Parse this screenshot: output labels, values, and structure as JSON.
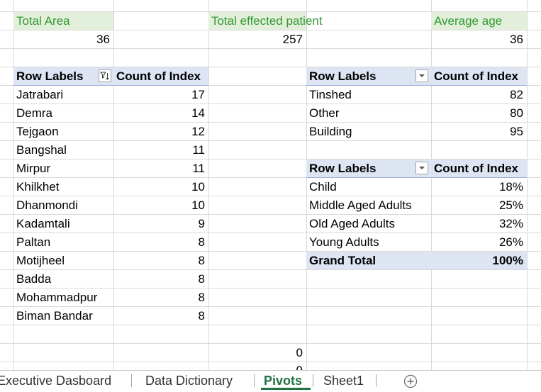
{
  "kpis": {
    "total_area_label": "Total Area",
    "total_area_value": "36",
    "total_patient_label": "Total effected patient",
    "total_patient_value": "257",
    "average_age_label": "Average age",
    "average_age_value": "36"
  },
  "pivot_area": {
    "header_label": "Row Labels",
    "header_value": "Count of Index",
    "rows": [
      {
        "label": "Jatrabari",
        "value": "17"
      },
      {
        "label": "Demra",
        "value": "14"
      },
      {
        "label": "Tejgaon",
        "value": "12"
      },
      {
        "label": "Bangshal",
        "value": "11"
      },
      {
        "label": "Mirpur",
        "value": "11"
      },
      {
        "label": "Khilkhet",
        "value": "10"
      },
      {
        "label": "Dhanmondi",
        "value": "10"
      },
      {
        "label": "Kadamtali",
        "value": "9"
      },
      {
        "label": "Paltan",
        "value": "8"
      },
      {
        "label": "Motijheel",
        "value": "8"
      },
      {
        "label": "Badda",
        "value": "8"
      },
      {
        "label": "Mohammadpur",
        "value": "8"
      },
      {
        "label": "Biman Bandar",
        "value": "8"
      }
    ]
  },
  "pivot_house": {
    "header_label": "Row Labels",
    "header_value": "Count of Index",
    "rows": [
      {
        "label": "Tinshed",
        "value": "82"
      },
      {
        "label": "Other",
        "value": "80"
      },
      {
        "label": "Building",
        "value": "95"
      }
    ]
  },
  "pivot_age": {
    "header_label": "Row Labels",
    "header_value": "Count of Index",
    "rows": [
      {
        "label": "Child",
        "value": "18%"
      },
      {
        "label": "Middle Aged Adults",
        "value": "25%"
      },
      {
        "label": "Old Aged Adults",
        "value": "32%"
      },
      {
        "label": "Young Adults",
        "value": "26%"
      }
    ],
    "total_label": "Grand Total",
    "total_value": "100%"
  },
  "stray_cells": {
    "zero_value": "0"
  },
  "tabs": {
    "items": [
      "Executive Dasboard",
      "Data Dictionary",
      "Pivots",
      "Sheet1"
    ],
    "active": "Pivots"
  },
  "colors": {
    "kpi_fill": "#e2efda",
    "kpi_text": "#339933",
    "pivot_header_fill": "#dde4f2",
    "active_tab": "#217346"
  },
  "icons": {
    "filter_active": "filter-sort-icon",
    "dropdown": "dropdown-arrow-icon",
    "add_sheet": "plus-circle-icon"
  }
}
